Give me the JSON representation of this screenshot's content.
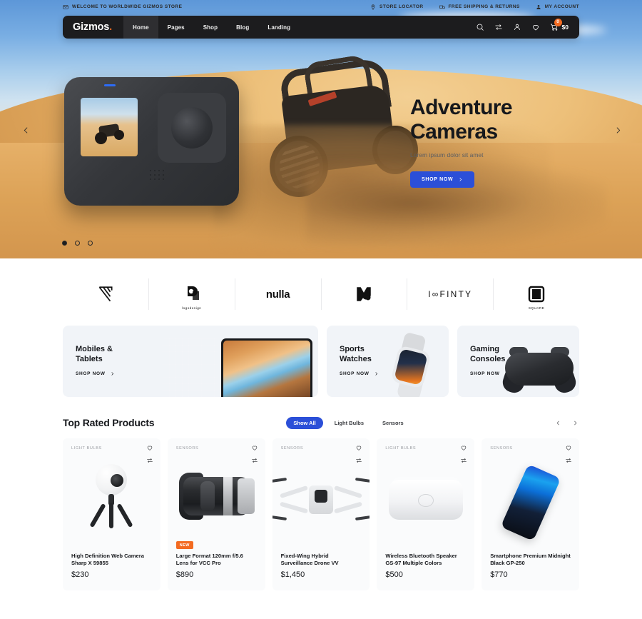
{
  "topbar": {
    "welcome": "WELCOME TO WORLDWIDE GIZMOS STORE",
    "store_locator": "STORE LOCATOR",
    "shipping": "FREE SHIPPING & RETURNS",
    "account": "MY ACCOUNT"
  },
  "nav": {
    "logo": "Gizmos",
    "logo_dot": ".",
    "links": [
      {
        "label": "Home",
        "active": true
      },
      {
        "label": "Pages",
        "active": false
      },
      {
        "label": "Shop",
        "active": false
      },
      {
        "label": "Blog",
        "active": false
      },
      {
        "label": "Landing",
        "active": false
      }
    ],
    "cart_count": "0",
    "cart_total": "$0"
  },
  "hero": {
    "title_line1": "Adventure",
    "title_line2": "Cameras",
    "subtitle": "Lorem ipsum dolor sit amet",
    "cta": "SHOP NOW",
    "slides": 3,
    "active_slide": 1
  },
  "brands": [
    {
      "name": "slashline-logo",
      "text": ""
    },
    {
      "name": "logodesign-logo",
      "text": "",
      "sub": "logodesign"
    },
    {
      "name": "nulla-logo",
      "text": "nulla"
    },
    {
      "name": "m-mark-logo",
      "text": ""
    },
    {
      "name": "infinty-logo",
      "text": "I∞FINTY"
    },
    {
      "name": "square-logo",
      "text": "",
      "sub": "SQUARE"
    }
  ],
  "categories": [
    {
      "title_line1": "Mobiles &",
      "title_line2": "Tablets",
      "link": "SHOP NOW"
    },
    {
      "title_line1": "Sports",
      "title_line2": "Watches",
      "link": "SHOP NOW"
    },
    {
      "title_line1": "Gaming",
      "title_line2": "Consoles",
      "link": "SHOP NOW"
    }
  ],
  "products_section": {
    "title": "Top Rated Products",
    "filters": [
      {
        "label": "Show All",
        "active": true
      },
      {
        "label": "Light Bulbs",
        "active": false
      },
      {
        "label": "Sensors",
        "active": false
      }
    ]
  },
  "products": [
    {
      "category": "LIGHT BULBS",
      "name": "High Definition Web Camera Sharp X 59855",
      "price": "$230",
      "badge": ""
    },
    {
      "category": "SENSORS",
      "name": "Large Format 120mm f/5.6 Lens for VCC Pro",
      "price": "$890",
      "badge": "NEW"
    },
    {
      "category": "SENSORS",
      "name": "Fixed-Wing Hybrid Surveillance Drone VV",
      "price": "$1,450",
      "badge": ""
    },
    {
      "category": "LIGHT BULBS",
      "name": "Wireless Bluetooth Speaker GS-97 Multiple Colors",
      "price": "$500",
      "badge": ""
    },
    {
      "category": "SENSORS",
      "name": "Smartphone Premium Midnight Black GP-250",
      "price": "$770",
      "badge": ""
    }
  ],
  "colors": {
    "accent_blue": "#2b4fd8",
    "accent_orange": "#f36b21",
    "nav_dark": "#1c1c1e",
    "card_gray": "#f1f4f8"
  }
}
